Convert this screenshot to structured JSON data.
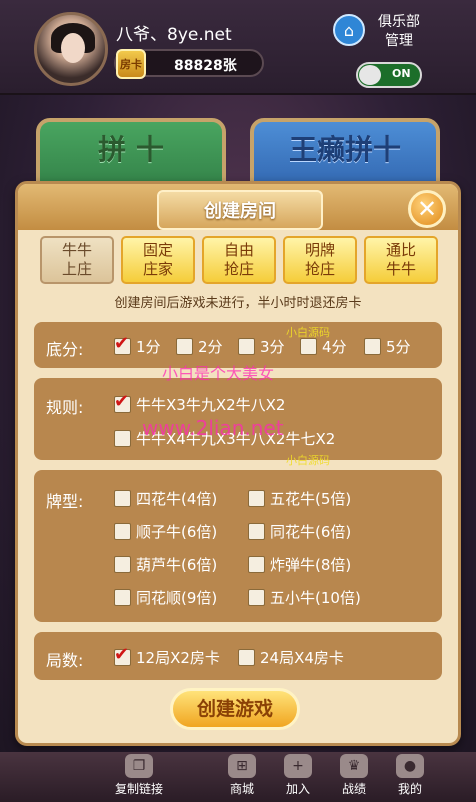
{
  "header": {
    "username": "八爷、8ye.net",
    "card_count": "88828张",
    "card_icon_text": "房卡",
    "club_label": "俱乐部\n管理",
    "toggle_text": "ON"
  },
  "background_tiles": {
    "left_title": "拼 十",
    "right_title": "王癞拼十"
  },
  "dialog": {
    "title": "创建房间",
    "close_symbol": "✕",
    "tabs": [
      {
        "label": "牛牛\n上庄",
        "active": true
      },
      {
        "label": "固定\n庄家",
        "active": false
      },
      {
        "label": "自由\n抢庄",
        "active": false
      },
      {
        "label": "明牌\n抢庄",
        "active": false
      },
      {
        "label": "通比\n牛牛",
        "active": false
      }
    ],
    "notice": "创建房间后游戏未进行，半小时时退还房卡",
    "base": {
      "label": "底分:",
      "options": [
        {
          "label": "1分",
          "checked": true
        },
        {
          "label": "2分",
          "checked": false
        },
        {
          "label": "3分",
          "checked": false
        },
        {
          "label": "4分",
          "checked": false
        },
        {
          "label": "5分",
          "checked": false
        }
      ]
    },
    "rules": {
      "label": "规则:",
      "options": [
        {
          "label": "牛牛X3牛九X2牛八X2",
          "checked": true
        },
        {
          "label": "牛牛X4牛九X3牛八X2牛七X2",
          "checked": false
        }
      ]
    },
    "card_types": {
      "label": "牌型:",
      "options": [
        {
          "label": "四花牛(4倍)",
          "checked": false
        },
        {
          "label": "五花牛(5倍)",
          "checked": false
        },
        {
          "label": "顺子牛(6倍)",
          "checked": false
        },
        {
          "label": "同花牛(6倍)",
          "checked": false
        },
        {
          "label": "葫芦牛(6倍)",
          "checked": false
        },
        {
          "label": "炸弹牛(8倍)",
          "checked": false
        },
        {
          "label": "同花顺(9倍)",
          "checked": false
        },
        {
          "label": "五小牛(10倍)",
          "checked": false
        }
      ]
    },
    "rounds": {
      "label": "局数:",
      "options": [
        {
          "label": "12局X2房卡",
          "checked": true
        },
        {
          "label": "24局X4房卡",
          "checked": false
        }
      ]
    },
    "create_button": "创建游戏"
  },
  "watermarks": {
    "w1": "小白源码",
    "w2": "小白是个大美女",
    "w3": "www.2lian.net",
    "w4": "小白源码"
  },
  "bottom_nav": [
    {
      "label": "复制链接",
      "icon": "copy-link-icon"
    },
    {
      "label": "商城",
      "icon": "cart-icon"
    },
    {
      "label": "加入",
      "icon": "add-user-icon"
    },
    {
      "label": "战绩",
      "icon": "trophy-icon"
    },
    {
      "label": "我的",
      "icon": "user-icon"
    }
  ]
}
